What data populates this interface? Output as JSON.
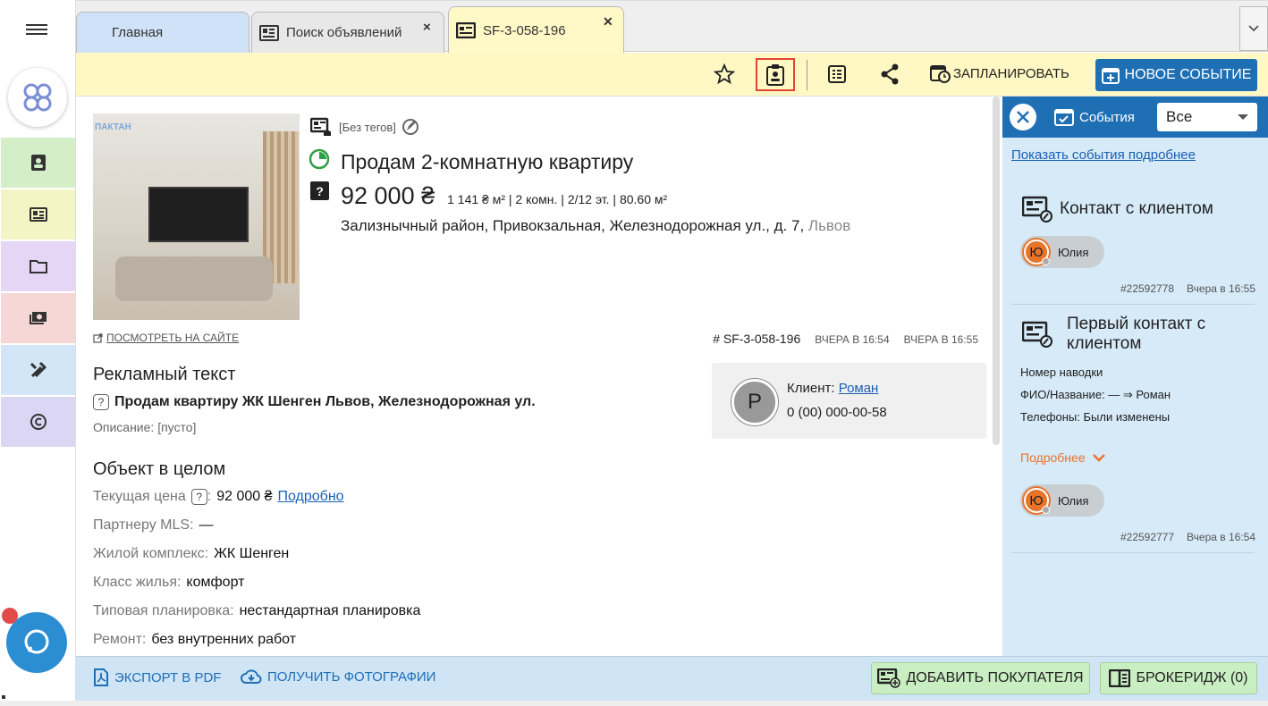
{
  "tabs": {
    "home": "Главная",
    "search": "Поиск объявлений",
    "active": "SF-3-058-196",
    "close": "×",
    "close_active": "✕"
  },
  "toolbar": {
    "schedule": "ЗАПЛАНИРОВАТЬ",
    "new_event": "НОВОЕ СОБЫТИЕ"
  },
  "listing": {
    "photo_watermark": "ПАКТАН",
    "tags": "[Без тегов]",
    "title": "Продам 2-комнатную квартиру",
    "price": "92 000 ₴",
    "price_details": "1 141 ₴ м² | 2 комн. | 2/12 эт. | 80.60 м²",
    "address": "Зализнычный район, Привокзальная, Железнодорожная ул., д. 7,",
    "city": "Львов",
    "site_link": "ПОСМОТРЕТЬ НА САЙТЕ",
    "ref_id": "# SF-3-058-196",
    "created": "ВЧЕРА В 16:54",
    "updated": "ВЧЕРА В 16:55"
  },
  "ad_text": {
    "heading": "Рекламный текст",
    "headline": "Продам квартиру ЖК Шенген Львов, Железнодорожная ул.",
    "description": "Описание: [пусто]"
  },
  "client": {
    "avatar": "P",
    "label": "Клиент:",
    "name": "Роман",
    "phone": "0 (00) 000-00-58"
  },
  "object": {
    "heading": "Объект в целом",
    "rows": [
      {
        "label": "Текущая цена",
        "value": "92 000 ₴",
        "link": "Подробно"
      },
      {
        "label": "Партнеру MLS:",
        "value": "—"
      },
      {
        "label": "Жилой комплекс:",
        "value": "ЖК Шенген"
      },
      {
        "label": "Класс жилья:",
        "value": "комфорт"
      },
      {
        "label": "Типовая планировка:",
        "value": "нестандартная планировка"
      },
      {
        "label": "Ремонт:",
        "value": "без внутренних работ"
      }
    ],
    "price_suffix": ":"
  },
  "panel": {
    "title": "События",
    "filter": "Все",
    "show_more_link": "Показать события подробнее",
    "events": [
      {
        "title": "Контакт с клиентом",
        "user": "Юлия",
        "avatar": "Ю",
        "id": "#22592778",
        "time": "Вчера в 16:55"
      },
      {
        "title_1": "Первый контакт с",
        "title_2": "клиентом",
        "line1": "Номер наводки",
        "line2": "ФИО/Название: — ⇒ Роман",
        "line3": "Телефоны: Были изменены",
        "more": "Подробнее",
        "user": "Юлия",
        "avatar": "Ю",
        "id": "#22592777",
        "time": "Вчера в 16:54"
      }
    ]
  },
  "bottom": {
    "export_pdf": "ЭКСПОРТ В PDF",
    "get_photos": "ПОЛУЧИТЬ ФОТОГРАФИИ",
    "add_buyer": "ДОБАВИТЬ ПОКУПАТЕЛЯ",
    "brokerage": "БРОКЕРИДЖ (0)"
  },
  "colors": {
    "accent": "#1f6fb5",
    "toolbar_bg": "#fff8c4",
    "panel_bg": "#d6eaf8",
    "green_btn": "#c9eec2",
    "highlight": "#e24430"
  },
  "icons": [
    "menu-icon",
    "logo-icon",
    "contacts-icon",
    "listings-icon",
    "folder-icon",
    "money-icon",
    "tools-icon",
    "copyright-icon",
    "chat-icon",
    "star-icon",
    "clipboard-icon",
    "calculator-icon",
    "share-icon",
    "calendar-icon",
    "plus-icon"
  ]
}
